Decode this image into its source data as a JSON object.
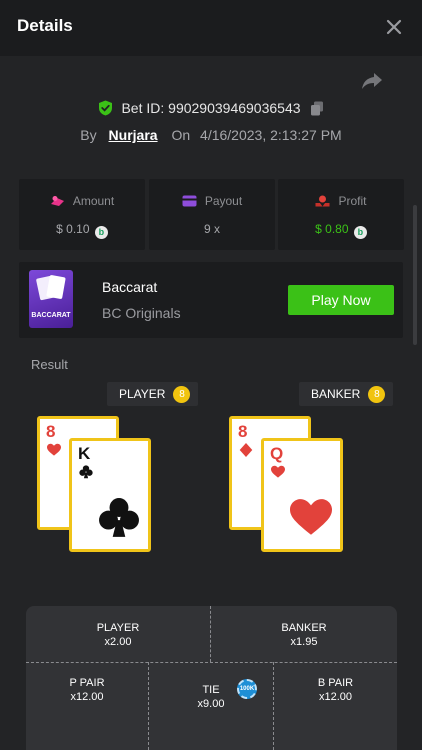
{
  "header": {
    "title": "Details",
    "close_icon": "close-icon"
  },
  "bet": {
    "id_label": "Bet ID:",
    "id": "99029039469036543",
    "by_label": "By",
    "user": "Nurjara",
    "on_label": "On",
    "datetime": "4/16/2023, 2:13:27 PM"
  },
  "stats": {
    "amount": {
      "label": "Amount",
      "value": "$ 0.10"
    },
    "payout": {
      "label": "Payout",
      "value": "9 x"
    },
    "profit": {
      "label": "Profit",
      "value": "$ 0.80"
    },
    "coin_glyph": "b"
  },
  "game": {
    "thumb_text": "BACCARAT",
    "name": "Baccarat",
    "provider": "BC Originals",
    "play_label": "Play Now"
  },
  "result": {
    "label": "Result",
    "player": {
      "label": "PLAYER",
      "score": "8",
      "cards": [
        {
          "rank": "8",
          "suit": "heart"
        },
        {
          "rank": "K",
          "suit": "club"
        }
      ]
    },
    "banker": {
      "label": "BANKER",
      "score": "8",
      "cards": [
        {
          "rank": "8",
          "suit": "diamond"
        },
        {
          "rank": "Q",
          "suit": "heart"
        }
      ]
    }
  },
  "bet_table": {
    "player": {
      "label": "PLAYER",
      "odds": "x2.00"
    },
    "banker": {
      "label": "BANKER",
      "odds": "x1.95"
    },
    "p_pair": {
      "label": "P PAIR",
      "odds": "x12.00"
    },
    "tie": {
      "label": "TIE",
      "odds": "x9.00",
      "chip": "100K"
    },
    "b_pair": {
      "label": "B PAIR",
      "odds": "x12.00"
    }
  },
  "colors": {
    "accent_green": "#3bc117",
    "card_border": "#f0c419",
    "bg": "#232426",
    "panel": "#1b1c1e"
  }
}
